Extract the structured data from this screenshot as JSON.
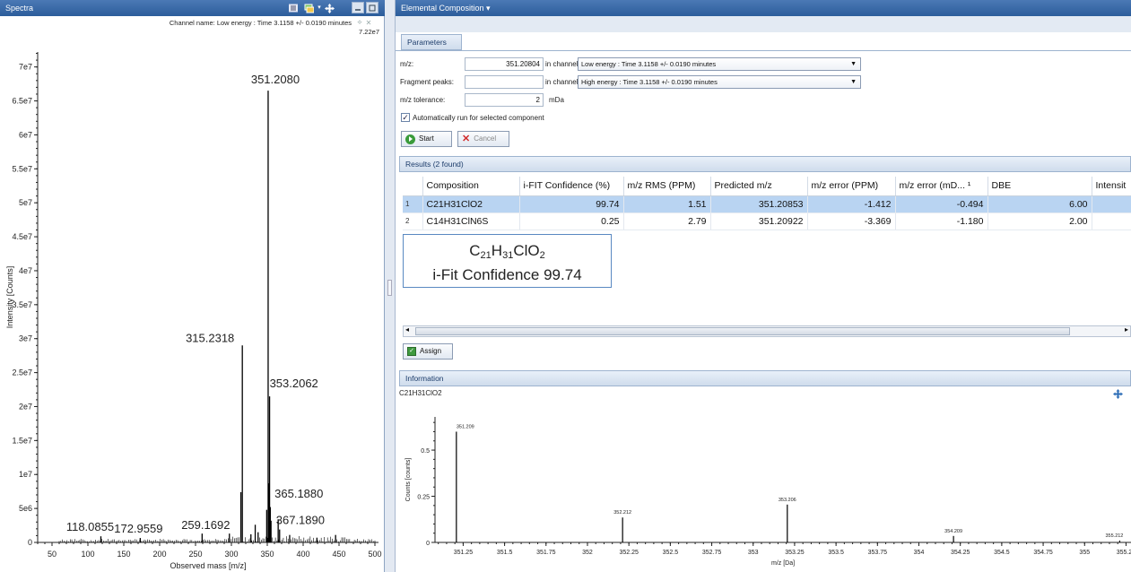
{
  "spectra": {
    "title": "Spectra",
    "channel_label": "Channel name: Low energy : Time 3.1158 +/- 0.0190 minutes",
    "max_intensity": "7.22e7",
    "icons": [
      "list-icon",
      "layers-icon",
      "move-icon",
      "minimize-icon",
      "maximize-icon",
      "pin-icon",
      "close-icon"
    ]
  },
  "chart_data": [
    {
      "type": "bar",
      "xlabel": "Observed mass [m/z]",
      "ylabel": "Intensity [Counts]",
      "xlim": [
        30,
        505
      ],
      "ylim": [
        0,
        72200000
      ],
      "x_ticks": [
        "50",
        "100",
        "150",
        "200",
        "250",
        "300",
        "350",
        "400",
        "450",
        "500"
      ],
      "y_ticks": [
        "0",
        "5e6",
        "1e7",
        "1.5e7",
        "2e7",
        "2.5e7",
        "3e7",
        "3.5e7",
        "4e7",
        "4.5e7",
        "5e7",
        "5.5e7",
        "6e7",
        "6.5e7",
        "7e7"
      ],
      "peaks": [
        {
          "x": 351.208,
          "y": 66500000,
          "label": "351.2080"
        },
        {
          "x": 315.2318,
          "y": 29000000,
          "label": "315.2318"
        },
        {
          "x": 353.2062,
          "y": 21500000,
          "label": "353.2062"
        },
        {
          "x": 313.2,
          "y": 7400000
        },
        {
          "x": 349.2,
          "y": 4800000
        },
        {
          "x": 352.2,
          "y": 8700000
        },
        {
          "x": 354.2,
          "y": 5200000
        },
        {
          "x": 355.2,
          "y": 3200000
        },
        {
          "x": 365.188,
          "y": 3400000,
          "label": "365.1880"
        },
        {
          "x": 367.189,
          "y": 1900000,
          "label": "367.1890"
        },
        {
          "x": 333.2,
          "y": 2600000
        },
        {
          "x": 337.2,
          "y": 1500000
        },
        {
          "x": 327.2,
          "y": 1200000
        },
        {
          "x": 297.2,
          "y": 1300000
        },
        {
          "x": 259.1692,
          "y": 1300000,
          "label": "259.1692"
        },
        {
          "x": 172.9559,
          "y": 650000,
          "label": "172.9559"
        },
        {
          "x": 118.0855,
          "y": 900000,
          "label": "118.0855"
        },
        {
          "x": 445.2,
          "y": 1100000
        },
        {
          "x": 381.2,
          "y": 1100000
        },
        {
          "x": 419.2,
          "y": 700000
        }
      ]
    },
    {
      "type": "bar",
      "title": "C21H31ClO2",
      "xlabel": "m/z [Da]",
      "ylabel": "Counts [counts]",
      "xlim": [
        351.08,
        355.28
      ],
      "ylim": [
        0,
        0.68
      ],
      "x_ticks": [
        "351.25",
        "351.5",
        "351.75",
        "352",
        "352.25",
        "352.5",
        "352.75",
        "353",
        "353.25",
        "353.5",
        "353.75",
        "354",
        "354.25",
        "354.5",
        "354.75",
        "355",
        "355.25"
      ],
      "y_ticks": [
        "0",
        "0.25",
        "0.5"
      ],
      "peaks": [
        {
          "x": 351.209,
          "y": 0.6,
          "label": "351.209"
        },
        {
          "x": 352.212,
          "y": 0.135,
          "label": "352.212"
        },
        {
          "x": 353.206,
          "y": 0.205,
          "label": "353.206"
        },
        {
          "x": 354.209,
          "y": 0.035,
          "label": "354.209"
        },
        {
          "x": 355.212,
          "y": 0.01,
          "label": "355.212"
        }
      ]
    }
  ],
  "elemental": {
    "title": "Elemental Composition ▾",
    "parameters_tab": "Parameters",
    "mz_label": "m/z:",
    "mz_value": "351.20804",
    "in_channel_1": "in channel:",
    "channel_1": "Low energy : Time 3.1158 +/- 0.0190 minutes",
    "fragment_label": "Fragment peaks:",
    "fragment_value": "",
    "in_channel_2": "in channel:",
    "channel_2": "High energy : Time 3.1158 +/- 0.0190 minutes",
    "tolerance_label": "m/z tolerance:",
    "tolerance_value": "2",
    "tolerance_unit": "mDa",
    "auto_run_label": "Automatically run for selected component",
    "start_label": "Start",
    "cancel_label": "Cancel"
  },
  "results": {
    "title": "Results (2 found)",
    "columns": [
      "Composition",
      "i-FIT Confidence (%)",
      "m/z RMS (PPM)",
      "Predicted m/z",
      "m/z error (PPM)",
      "m/z error (mD... ¹",
      "DBE",
      "Intensit"
    ],
    "rows": [
      [
        "1",
        "C21H31ClO2",
        "99.74",
        "1.51",
        "351.20853",
        "-1.412",
        "-0.494",
        "6.00",
        ""
      ],
      [
        "2",
        "C14H31ClN6S",
        "0.25",
        "2.79",
        "351.20922",
        "-3.369",
        "-1.180",
        "2.00",
        ""
      ]
    ],
    "assign_label": "Assign"
  },
  "callout": {
    "formula_c": "C",
    "formula_c_n": "21",
    "formula_h": "H",
    "formula_h_n": "31",
    "formula_cl_o": "ClO",
    "formula_o_n": "2",
    "confidence_text": "i-Fit Confidence 99.74"
  },
  "information": {
    "title": "Information",
    "formula": "C21H31ClO2"
  }
}
